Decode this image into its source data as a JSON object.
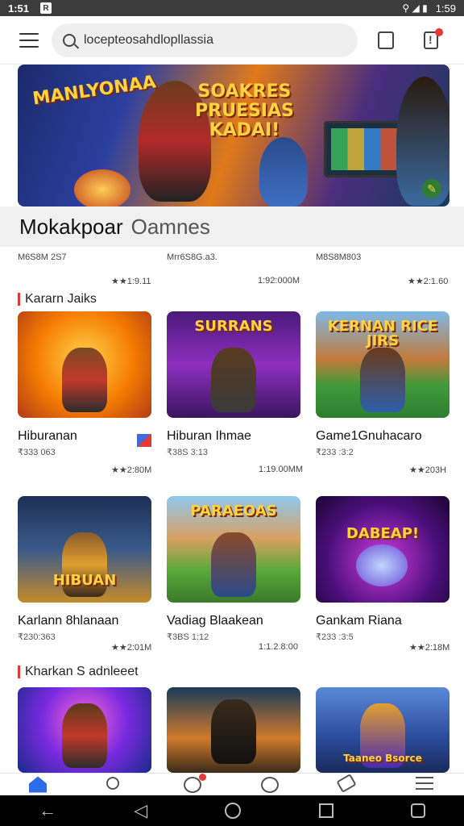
{
  "status_bar": {
    "time": "1:51",
    "app_badge": "R",
    "signal": "⚲ ◢ ▮",
    "battery": "1:59"
  },
  "search": {
    "query": "locepteosahdlopllassia"
  },
  "banner": {
    "title_left": "MANLYONAA",
    "title_mid_1": "SOAKRES",
    "title_mid_2": "PRUESIAS",
    "title_mid_3": "KADAI!"
  },
  "section_main": {
    "title": "Mokakpoar",
    "subtitle": "Oamnes"
  },
  "top_meta": {
    "cols": [
      "M6S8M 2S7",
      "Mrr6S8G.a3.",
      "M8S8M803"
    ],
    "stats": [
      "★★1:9.11",
      "1:92:000M",
      "★★2:1.60"
    ]
  },
  "section_a": {
    "title": "Kararn Jaiks"
  },
  "section_b": {
    "title": "Kharkan S adnleeet"
  },
  "row1": [
    {
      "title": "Hiburanan",
      "meta": "₹333 063",
      "stats": "★★2:80M",
      "thumb_label": ""
    },
    {
      "title": "Hiburan Ihmae",
      "meta": "₹38S 3:13",
      "stats": "1:19.00MM",
      "thumb_label": "SURRANS"
    },
    {
      "title": "Game1Gnuhacaro",
      "meta": "₹233 :3:2",
      "stats": "★★203H",
      "thumb_label": "KERNAN RICE JIRS"
    }
  ],
  "row2": [
    {
      "title": "Karlann 8hlanaan",
      "meta": "₹230:363",
      "stats": "★★2:01M",
      "thumb_label": "HIBUAN"
    },
    {
      "title": "Vadiag Blaakean",
      "meta": "₹3BS 1:12",
      "stats": "1:1.2.8:00",
      "thumb_label": "PARAEOAS"
    },
    {
      "title": "Gankam Riana",
      "meta": "₹233 :3:5",
      "stats": "★★2:18M",
      "thumb_label": "DABEAP!"
    }
  ],
  "row3": [
    {
      "thumb_label": ""
    },
    {
      "thumb_label": ""
    },
    {
      "thumb_label": "Taaneo Bsorce"
    }
  ],
  "colors": {
    "accent": "#2e6be6",
    "red": "#e53935"
  }
}
